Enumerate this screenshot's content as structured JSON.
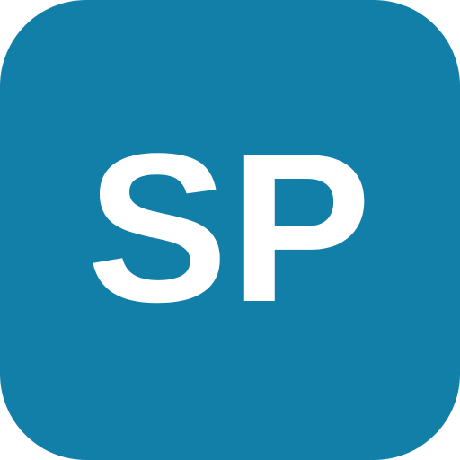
{
  "icon": {
    "label": "SP",
    "background_color": "#127FA9",
    "text_color": "#FFFFFF"
  }
}
